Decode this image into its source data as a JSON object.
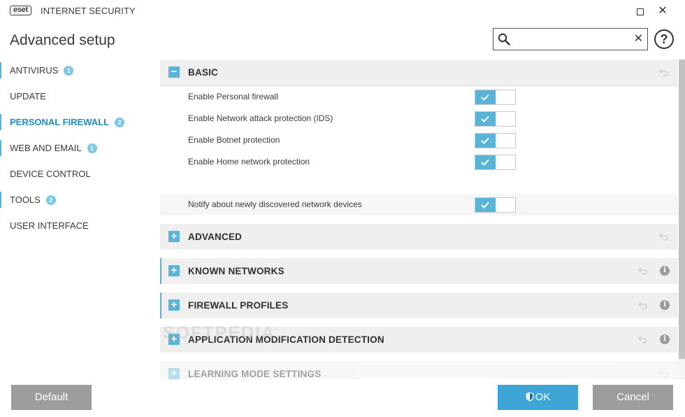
{
  "app": {
    "logo": "eset",
    "product": "INTERNET SECURITY"
  },
  "window": {
    "maximize_icon": "maximize-icon",
    "close_icon": "close-icon",
    "close_glyph": "✕"
  },
  "header": {
    "title": "Advanced setup",
    "search_placeholder": "",
    "search_value": "",
    "clear_glyph": "✕",
    "help_glyph": "?"
  },
  "sidebar": {
    "items": [
      {
        "label": "ANTIVIRUS",
        "badge": "1"
      },
      {
        "label": "UPDATE",
        "badge": ""
      },
      {
        "label": "PERSONAL FIREWALL",
        "badge": "2",
        "active": true
      },
      {
        "label": "WEB AND EMAIL",
        "badge": "1"
      },
      {
        "label": "DEVICE CONTROL",
        "badge": ""
      },
      {
        "label": "TOOLS",
        "badge": "2"
      },
      {
        "label": "USER INTERFACE",
        "badge": ""
      }
    ]
  },
  "sections": {
    "basic": {
      "title": "BASIC",
      "toggle": "−",
      "expanded": true
    },
    "advanced": {
      "title": "ADVANCED",
      "toggle": "+"
    },
    "known_networks": {
      "title": "KNOWN NETWORKS",
      "toggle": "+",
      "info": "i"
    },
    "firewall_profiles": {
      "title": "FIREWALL PROFILES",
      "toggle": "+",
      "info": "i"
    },
    "app_mod_detection": {
      "title": "APPLICATION MODIFICATION DETECTION",
      "toggle": "+",
      "info": "i"
    },
    "learning_mode": {
      "title": "LEARNING MODE SETTINGS",
      "toggle": "+"
    }
  },
  "settings": [
    {
      "label": "Enable Personal firewall",
      "enabled": true
    },
    {
      "label": "Enable Network attack protection (IDS)",
      "enabled": true
    },
    {
      "label": "Enable Botnet protection",
      "enabled": true
    },
    {
      "label": "Enable Home network protection",
      "enabled": true
    },
    {
      "label": "Notify about newly discovered network devices",
      "enabled": true
    }
  ],
  "watermark": "SOFTPEDIA",
  "footer": {
    "default_label": "Default",
    "ok_label": "OK",
    "cancel_label": "Cancel"
  },
  "colors": {
    "accent": "#5ab4d8",
    "ok_button": "#3fa4d6",
    "neutral_button": "#9d9d9d",
    "section_bg": "#efefef",
    "active_nav": "#1d8ec6"
  }
}
